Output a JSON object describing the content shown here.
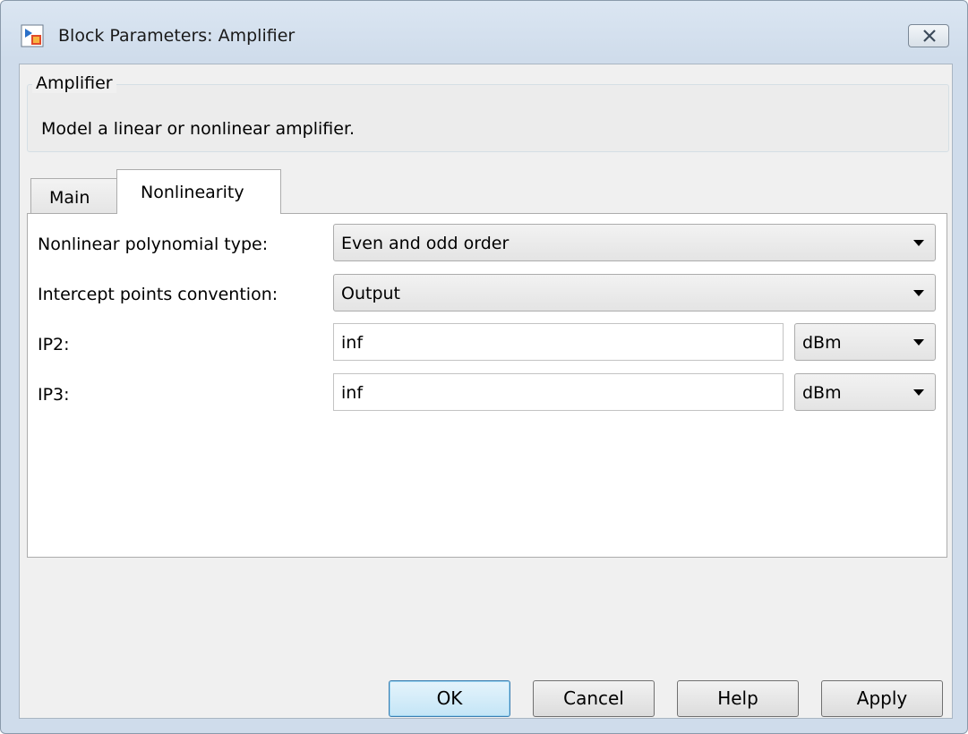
{
  "window": {
    "title": "Block Parameters: Amplifier"
  },
  "description": {
    "group_title": "Amplifier",
    "text": "Model a linear or nonlinear amplifier."
  },
  "tabs": [
    {
      "label": "Main",
      "selected": false
    },
    {
      "label": "Nonlinearity",
      "selected": true
    }
  ],
  "fields": {
    "poly_type": {
      "label": "Nonlinear polynomial type:",
      "value": "Even and odd order"
    },
    "intercept": {
      "label": "Intercept points convention:",
      "value": "Output"
    },
    "ip2": {
      "label": "IP2:",
      "value": "inf",
      "unit": "dBm"
    },
    "ip3": {
      "label": "IP3:",
      "value": "inf",
      "unit": "dBm"
    }
  },
  "buttons": {
    "ok": "OK",
    "cancel": "Cancel",
    "help": "Help",
    "apply": "Apply"
  },
  "icons": {
    "app": "simulink-block-icon",
    "close": "close-icon",
    "dropdown": "dropdown-arrow-icon"
  },
  "colors": {
    "title_bar": "#cfdceb",
    "client_bg": "#f0f0f0",
    "default_button": "#c4e5f6"
  }
}
